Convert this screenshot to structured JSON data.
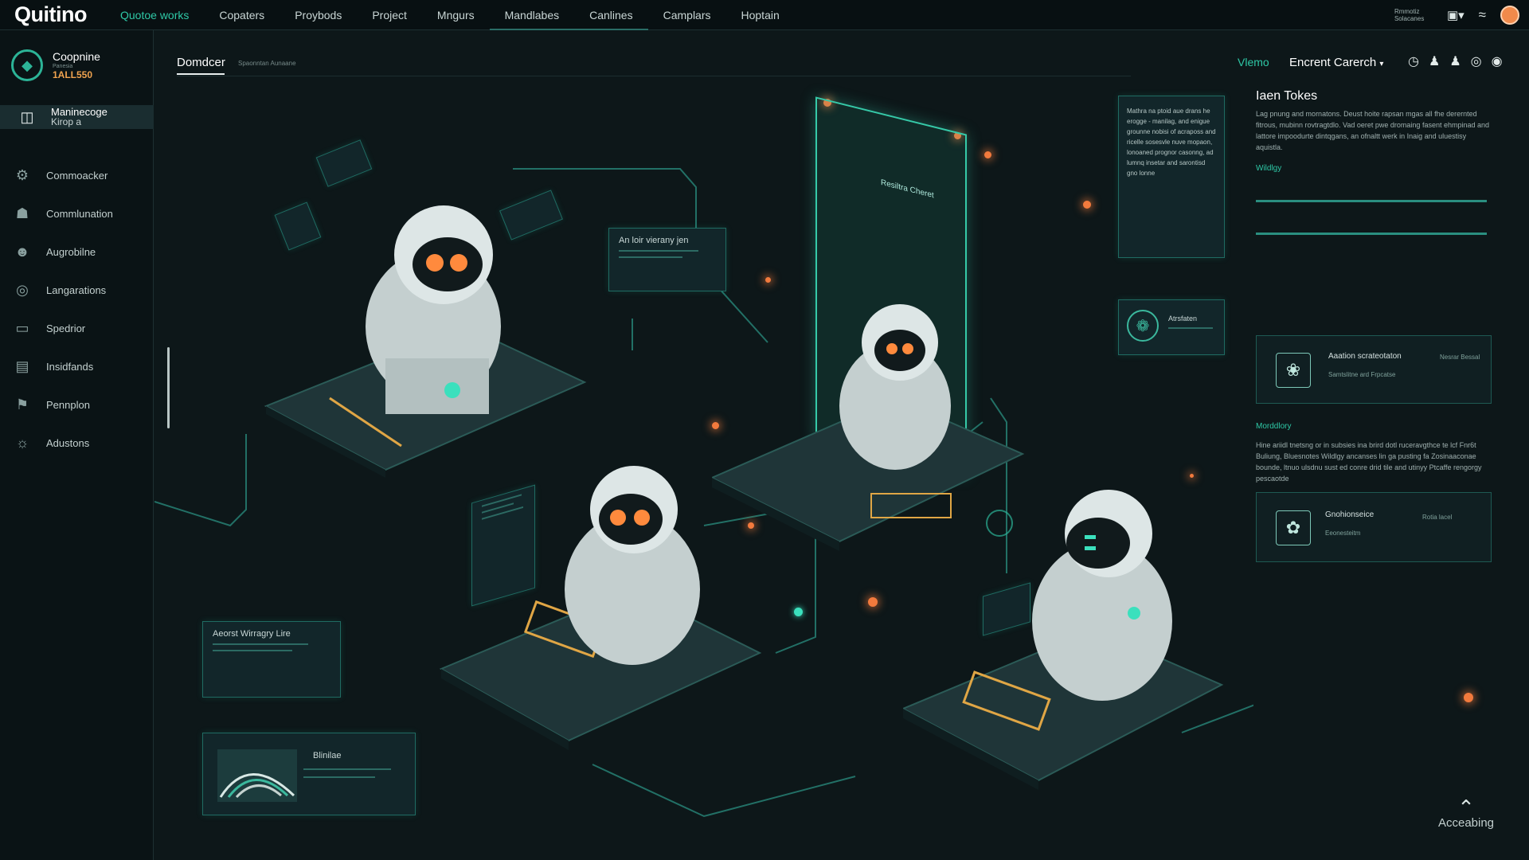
{
  "app": {
    "brand": "Quitino"
  },
  "topnav": [
    {
      "label": "Quotoe works",
      "active": true
    },
    {
      "label": "Copaters"
    },
    {
      "label": "Proybods"
    },
    {
      "label": "Project"
    },
    {
      "label": "Mngurs"
    },
    {
      "label": "Mandlabes",
      "highlight": true
    },
    {
      "label": "Canlines",
      "highlight": true
    },
    {
      "label": "Camplars"
    },
    {
      "label": "Hoptain"
    }
  ],
  "topright": {
    "info": "Rmmotiz Solacanes"
  },
  "sidebar": {
    "org": {
      "name": "Coopnine",
      "sub": "Panesia",
      "code": "1ALL550"
    },
    "active": {
      "label": "Maninecoge",
      "sublabel": "Kirop a"
    },
    "items": [
      {
        "label": "Commoacker",
        "icon": "gear-icon"
      },
      {
        "label": "Commlunation",
        "icon": "network-icon"
      },
      {
        "label": "Augrobilne",
        "icon": "agent-icon"
      },
      {
        "label": "Langarations",
        "icon": "target-icon"
      },
      {
        "label": "Spedrior",
        "icon": "monitor-icon"
      },
      {
        "label": "Insidfands",
        "icon": "document-icon"
      },
      {
        "label": "Pennplon",
        "icon": "flag-icon"
      },
      {
        "label": "Adustons",
        "icon": "settings-icon"
      }
    ]
  },
  "header": {
    "crumb": "Domdcer",
    "crumb_sub": "Spaonntan Aunaane",
    "view_label": "Vlemo",
    "search_label": "Encrent Carerch"
  },
  "canvas": {
    "note_card": "An loir vierany jen",
    "glass_label": "Resiltra Cheret",
    "memory_card": "Aeorst Wirragry Lire",
    "chart_card": "Blinilae",
    "tag_card": "Atrsfaten",
    "text_block": "Mathra na ptoid aue drans he erogge - manilag, and enigue grounne nobisi of acraposs and ricelle sosesvle nuve mopaon, lonoaned prognor casonng, ad lumnq insetar and sarontisd gno lonne"
  },
  "rpanel": {
    "title": "Iaen Tokes",
    "body": "Lag pnung and mornatons. Deust hoite rapsan mgas all fhe derernted fitrous, mubinn rovtragtdlo. Vad oeret pwe dromaing fasent ehmpinad and lattore impoodurte dintqgans, an ofnaltt werk in Inaig and uluestisy aquistla.",
    "sections": [
      "Wildlgy",
      "Morddlory"
    ],
    "section_text": "Hine ariidl tnetsng or in subsies ina brird dotl ruceravgthce te lcf Fnr6t Buliung, Bluesnotes Wildlgy ancanses lin ga pusting fa Zosinaaconae bounde, ltnuo ulsdnu sust ed conre drid tile and utinyy Ptcaffe rengorgy pescaotde",
    "cards": [
      {
        "title": "Aaation scrateotaton",
        "sub": "Nesrar Bessal",
        "tag": "Samtslitne ard Frpcatse"
      },
      {
        "title": "Gnohionseice",
        "sub": "Rotia lacel",
        "tag": "Eeonesteitm"
      }
    ]
  },
  "accessibility": {
    "label": "Acceabing"
  },
  "colors": {
    "accent": "#2ec8a6",
    "glow": "#f27a3d",
    "background": "#0d1719"
  }
}
